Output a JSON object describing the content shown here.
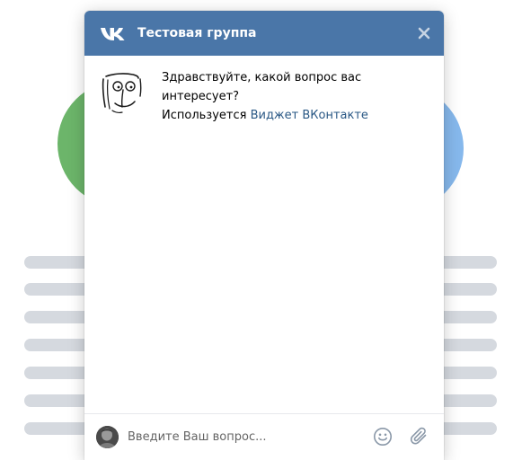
{
  "header": {
    "title": "Тестовая группа",
    "close_icon": "close-icon",
    "logo_icon": "vk-logo-icon",
    "background_color": "#4a76a8"
  },
  "message": {
    "lines": [
      "Здравствуйте, какой вопрос вас",
      "интересует?"
    ],
    "powered_prefix": "Используется ",
    "powered_link": "Виджет ВКонтакте",
    "link_color": "#2a5885"
  },
  "composer": {
    "placeholder": "Введите Ваш вопрос...",
    "emoji_icon": "smile-icon",
    "attach_icon": "paperclip-icon"
  }
}
